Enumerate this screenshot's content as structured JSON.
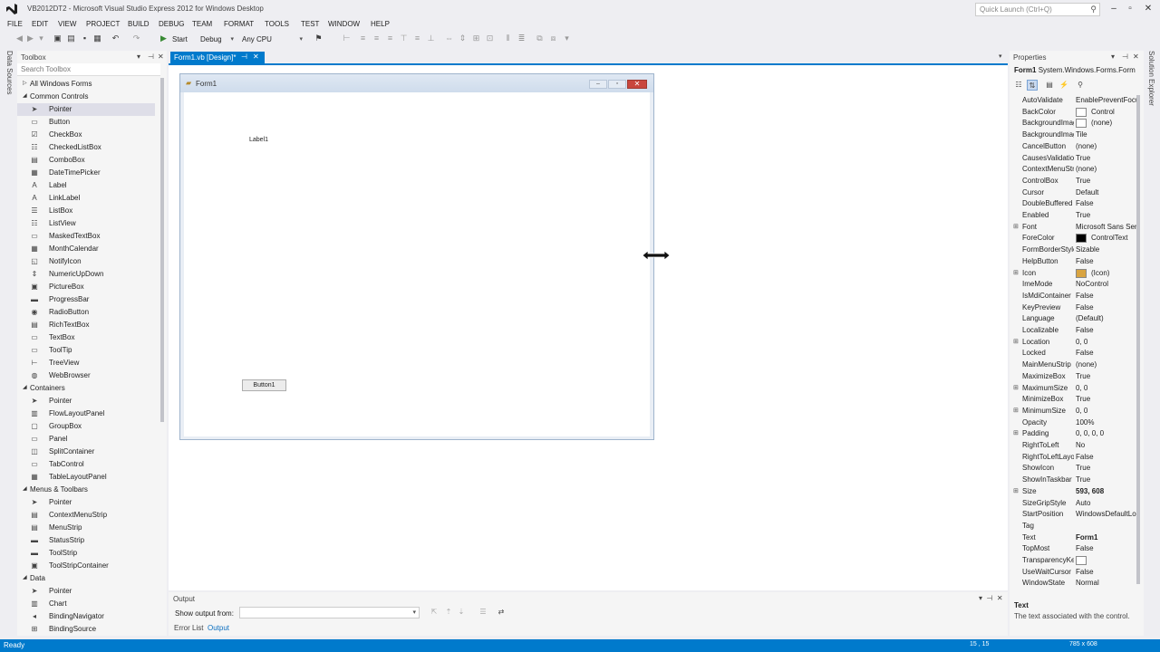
{
  "window": {
    "title": "VB2012DT2 - Microsoft Visual Studio Express 2012 for Windows Desktop",
    "quick_launch_placeholder": "Quick Launch (Ctrl+Q)"
  },
  "menu": [
    "FILE",
    "EDIT",
    "VIEW",
    "PROJECT",
    "BUILD",
    "DEBUG",
    "TEAM",
    "FORMAT",
    "TOOLS",
    "TEST",
    "WINDOW",
    "HELP"
  ],
  "toolbar": {
    "start_label": "Start",
    "config_value": "Debug",
    "platform_value": "Any CPU"
  },
  "side_tabs": {
    "left": "Data Sources",
    "right": "Solution Explorer"
  },
  "toolbox": {
    "title": "Toolbox",
    "search_placeholder": "Search Toolbox",
    "items": [
      {
        "type": "group",
        "label": "All Windows Forms",
        "expanded": false
      },
      {
        "type": "group",
        "label": "Common Controls",
        "expanded": true
      },
      {
        "type": "item",
        "label": "Pointer",
        "icon": "pointer-icon",
        "selected": true
      },
      {
        "type": "item",
        "label": "Button",
        "icon": "button-icon"
      },
      {
        "type": "item",
        "label": "CheckBox",
        "icon": "checkbox-icon"
      },
      {
        "type": "item",
        "label": "CheckedListBox",
        "icon": "checkedlistbox-icon"
      },
      {
        "type": "item",
        "label": "ComboBox",
        "icon": "combobox-icon"
      },
      {
        "type": "item",
        "label": "DateTimePicker",
        "icon": "datetimepicker-icon"
      },
      {
        "type": "item",
        "label": "Label",
        "icon": "label-icon"
      },
      {
        "type": "item",
        "label": "LinkLabel",
        "icon": "linklabel-icon"
      },
      {
        "type": "item",
        "label": "ListBox",
        "icon": "listbox-icon"
      },
      {
        "type": "item",
        "label": "ListView",
        "icon": "listview-icon"
      },
      {
        "type": "item",
        "label": "MaskedTextBox",
        "icon": "maskedtextbox-icon"
      },
      {
        "type": "item",
        "label": "MonthCalendar",
        "icon": "monthcalendar-icon"
      },
      {
        "type": "item",
        "label": "NotifyIcon",
        "icon": "notifyicon-icon"
      },
      {
        "type": "item",
        "label": "NumericUpDown",
        "icon": "numericupdown-icon"
      },
      {
        "type": "item",
        "label": "PictureBox",
        "icon": "picturebox-icon"
      },
      {
        "type": "item",
        "label": "ProgressBar",
        "icon": "progressbar-icon"
      },
      {
        "type": "item",
        "label": "RadioButton",
        "icon": "radiobutton-icon"
      },
      {
        "type": "item",
        "label": "RichTextBox",
        "icon": "richtextbox-icon"
      },
      {
        "type": "item",
        "label": "TextBox",
        "icon": "textbox-icon"
      },
      {
        "type": "item",
        "label": "ToolTip",
        "icon": "tooltip-icon"
      },
      {
        "type": "item",
        "label": "TreeView",
        "icon": "treeview-icon"
      },
      {
        "type": "item",
        "label": "WebBrowser",
        "icon": "webbrowser-icon"
      },
      {
        "type": "group",
        "label": "Containers",
        "expanded": true
      },
      {
        "type": "item",
        "label": "Pointer",
        "icon": "pointer-icon"
      },
      {
        "type": "item",
        "label": "FlowLayoutPanel",
        "icon": "flowlayoutpanel-icon"
      },
      {
        "type": "item",
        "label": "GroupBox",
        "icon": "groupbox-icon"
      },
      {
        "type": "item",
        "label": "Panel",
        "icon": "panel-icon"
      },
      {
        "type": "item",
        "label": "SplitContainer",
        "icon": "splitcontainer-icon"
      },
      {
        "type": "item",
        "label": "TabControl",
        "icon": "tabcontrol-icon"
      },
      {
        "type": "item",
        "label": "TableLayoutPanel",
        "icon": "tablelayoutpanel-icon"
      },
      {
        "type": "group",
        "label": "Menus & Toolbars",
        "expanded": true
      },
      {
        "type": "item",
        "label": "Pointer",
        "icon": "pointer-icon"
      },
      {
        "type": "item",
        "label": "ContextMenuStrip",
        "icon": "contextmenustrip-icon"
      },
      {
        "type": "item",
        "label": "MenuStrip",
        "icon": "menustrip-icon"
      },
      {
        "type": "item",
        "label": "StatusStrip",
        "icon": "statusstrip-icon"
      },
      {
        "type": "item",
        "label": "ToolStrip",
        "icon": "toolstrip-icon"
      },
      {
        "type": "item",
        "label": "ToolStripContainer",
        "icon": "toolstripcontainer-icon"
      },
      {
        "type": "group",
        "label": "Data",
        "expanded": true
      },
      {
        "type": "item",
        "label": "Pointer",
        "icon": "pointer-icon"
      },
      {
        "type": "item",
        "label": "Chart",
        "icon": "chart-icon"
      },
      {
        "type": "item",
        "label": "BindingNavigator",
        "icon": "bindingnavigator-icon"
      },
      {
        "type": "item",
        "label": "BindingSource",
        "icon": "bindingsource-icon"
      }
    ]
  },
  "document": {
    "tab_label": "Form1.vb [Design]*",
    "form": {
      "title": "Form1",
      "label_text": "Label1",
      "button_text": "Button1"
    }
  },
  "output": {
    "title": "Output",
    "show_from_label": "Show output from:",
    "show_from_value": "",
    "tabs": [
      "Error List",
      "Output"
    ]
  },
  "properties": {
    "title": "Properties",
    "object_name": "Form1",
    "object_type": "System.Windows.Forms.Form",
    "rows": [
      {
        "name": "AutoValidate",
        "value": "EnablePreventFocusChange"
      },
      {
        "name": "BackColor",
        "value": "Control",
        "swatch": "#ffffff"
      },
      {
        "name": "BackgroundImage",
        "value": "(none)",
        "swatch": "#ffffff"
      },
      {
        "name": "BackgroundImageLayout",
        "value": "Tile"
      },
      {
        "name": "CancelButton",
        "value": "(none)"
      },
      {
        "name": "CausesValidation",
        "value": "True"
      },
      {
        "name": "ContextMenuStrip",
        "value": "(none)"
      },
      {
        "name": "ControlBox",
        "value": "True"
      },
      {
        "name": "Cursor",
        "value": "Default"
      },
      {
        "name": "DoubleBuffered",
        "value": "False"
      },
      {
        "name": "Enabled",
        "value": "True"
      },
      {
        "name": "Font",
        "value": "Microsoft Sans Serif",
        "expandable": true
      },
      {
        "name": "ForeColor",
        "value": "ControlText",
        "swatch": "#000000"
      },
      {
        "name": "FormBorderStyle",
        "value": "Sizable"
      },
      {
        "name": "HelpButton",
        "value": "False"
      },
      {
        "name": "Icon",
        "value": "(Icon)",
        "expandable": true,
        "swatch": "#d9a441"
      },
      {
        "name": "ImeMode",
        "value": "NoControl"
      },
      {
        "name": "IsMdiContainer",
        "value": "False"
      },
      {
        "name": "KeyPreview",
        "value": "False"
      },
      {
        "name": "Language",
        "value": "(Default)"
      },
      {
        "name": "Localizable",
        "value": "False"
      },
      {
        "name": "Location",
        "value": "0, 0",
        "expandable": true
      },
      {
        "name": "Locked",
        "value": "False"
      },
      {
        "name": "MainMenuStrip",
        "value": "(none)"
      },
      {
        "name": "MaximizeBox",
        "value": "True"
      },
      {
        "name": "MaximumSize",
        "value": "0, 0",
        "expandable": true
      },
      {
        "name": "MinimizeBox",
        "value": "True"
      },
      {
        "name": "MinimumSize",
        "value": "0, 0",
        "expandable": true
      },
      {
        "name": "Opacity",
        "value": "100%"
      },
      {
        "name": "Padding",
        "value": "0, 0, 0, 0",
        "expandable": true
      },
      {
        "name": "RightToLeft",
        "value": "No"
      },
      {
        "name": "RightToLeftLayout",
        "value": "False"
      },
      {
        "name": "ShowIcon",
        "value": "True"
      },
      {
        "name": "ShowInTaskbar",
        "value": "True"
      },
      {
        "name": "Size",
        "value": "593, 608",
        "expandable": true,
        "bold": true
      },
      {
        "name": "SizeGripStyle",
        "value": "Auto"
      },
      {
        "name": "StartPosition",
        "value": "WindowsDefaultLocation"
      },
      {
        "name": "Tag",
        "value": ""
      },
      {
        "name": "Text",
        "value": "Form1",
        "bold": true
      },
      {
        "name": "TopMost",
        "value": "False"
      },
      {
        "name": "TransparencyKey",
        "value": "",
        "swatch": "#ffffff"
      },
      {
        "name": "UseWaitCursor",
        "value": "False"
      },
      {
        "name": "WindowState",
        "value": "Normal"
      }
    ],
    "description_title": "Text",
    "description_text": "The text associated with the control."
  },
  "statusbar": {
    "status": "Ready",
    "position": "15 , 15",
    "size": "785 x 608"
  },
  "colors": {
    "accent": "#007acc",
    "chrome": "#eeeef2"
  }
}
